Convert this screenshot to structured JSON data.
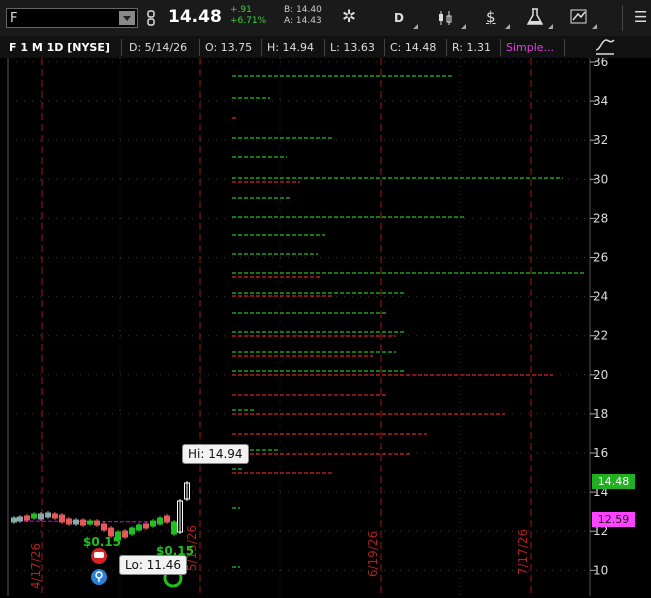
{
  "toolbar": {
    "symbol_value": "F",
    "last_price": "14.48",
    "change_abs": "+.91",
    "change_pct": "+6.71%",
    "bid": "B: 14.40",
    "ask": "A: 14.43",
    "period_button": "D",
    "dollar_icon": "$",
    "gear_icon": "✲",
    "menu_icon": "☰"
  },
  "header": {
    "title": "F 1 M 1D [NYSE]",
    "date": "D: 5/14/26",
    "open": "O: 13.75",
    "high": "H: 14.94",
    "low": "L: 13.63",
    "close": "C: 14.48",
    "range": "R: 1.31",
    "study": "Simple..."
  },
  "axis": {
    "ticks": [
      "36",
      "34",
      "32",
      "30",
      "28",
      "26",
      "24",
      "22",
      "20",
      "18",
      "16",
      "14",
      "12",
      "10"
    ]
  },
  "tags": {
    "current": "14.48",
    "average": "12.59"
  },
  "dates": {
    "d1": "4/17/26",
    "d2": "5/15/26",
    "d3": "6/19/26",
    "d4": "7/17/26"
  },
  "callouts": {
    "hi": "Hi: 14.94",
    "lo": "Lo: 11.46"
  },
  "dividends": {
    "div1": "$0.15",
    "div2": "$0.15"
  },
  "colors": {
    "green": "#21c021",
    "red": "#d62222",
    "accent": "#ff00ff",
    "bg": "#000000"
  }
}
